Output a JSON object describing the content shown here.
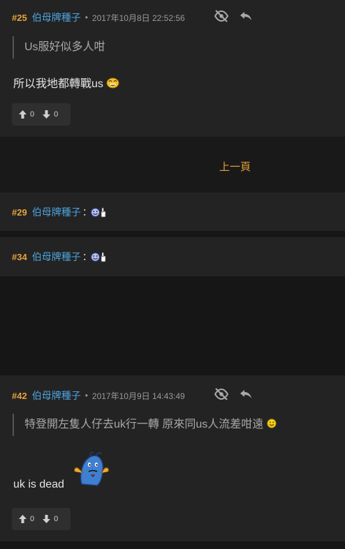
{
  "posts": [
    {
      "number": "#25",
      "author": "伯母牌種子",
      "separator": "•",
      "time": "2017年10月8日 22:52:56",
      "quote": "Us服好似多人咁",
      "body": "所以我地都轉戰us",
      "votes": {
        "up": "0",
        "down": "0"
      }
    },
    {
      "number": "#29",
      "author": "伯母牌種子",
      "colon": "："
    },
    {
      "number": "#34",
      "author": "伯母牌種子",
      "colon": "："
    },
    {
      "number": "#42",
      "author": "伯母牌種子",
      "separator": "•",
      "time": "2017年10月9日 14:43:49",
      "quote": "特登開左隻人仔去uk行一轉 原來同us人流差咁遠",
      "body": "uk is dead",
      "votes": {
        "up": "0",
        "down": "0"
      }
    }
  ],
  "pager": {
    "prev_label": "上一頁"
  },
  "colors": {
    "accent": "#e6a23c",
    "author": "#4ea3dd",
    "card": "#232323",
    "page": "#161616"
  },
  "icons": [
    "eye-off-icon",
    "reply-icon",
    "arrow-up-icon",
    "arrow-down-icon",
    "laugh-emoji-icon",
    "thumbs-up-emoji-icon",
    "smile-emoji-icon",
    "sticker-icon"
  ]
}
